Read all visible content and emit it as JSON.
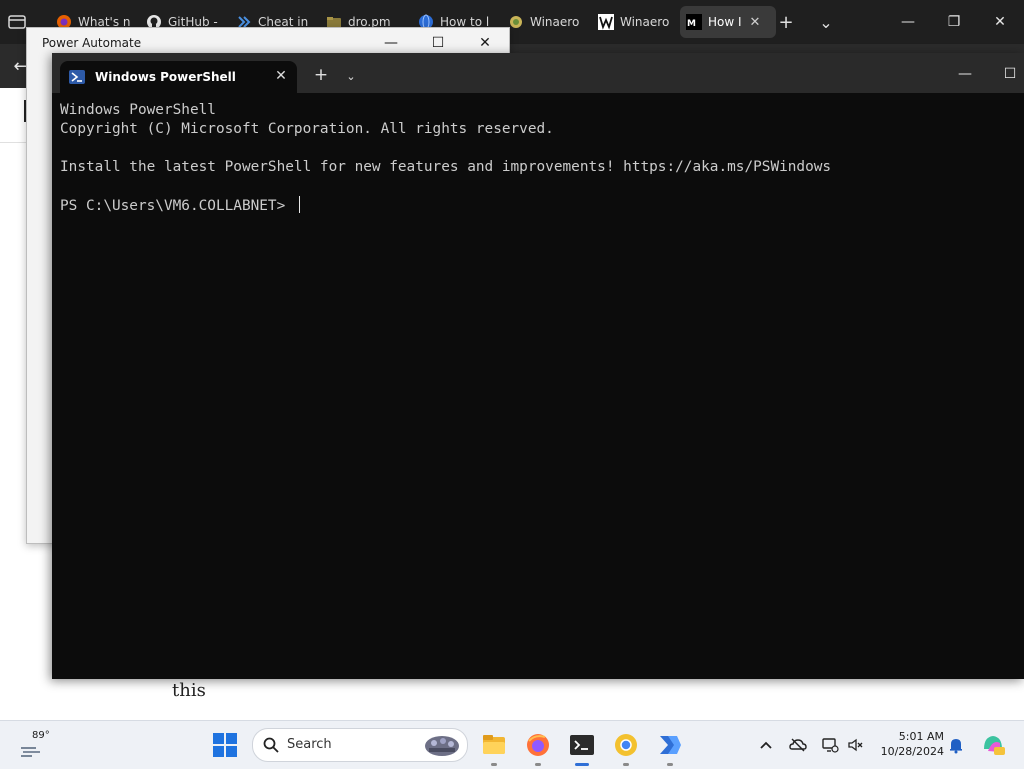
{
  "browser": {
    "tabs": [
      {
        "label": "What's n",
        "icon": "firefox-icon"
      },
      {
        "label": "GitHub -",
        "icon": "github-icon"
      },
      {
        "label": "Cheat in",
        "icon": "chevrons-icon"
      },
      {
        "label": "dro.pm",
        "icon": "folder-icon"
      },
      {
        "label": "How to l",
        "icon": "globe-icon"
      },
      {
        "label": "Winaero",
        "icon": "winaero-icon"
      },
      {
        "label": "Winaero",
        "icon": "w-logo-icon"
      },
      {
        "label": "How I",
        "icon": "medium-icon",
        "active": true
      }
    ],
    "active_close": "✕",
    "new_tab": "+",
    "list_tabs": "⌄",
    "minimize": "—",
    "restore": "❐",
    "close": "✕",
    "back": "←"
  },
  "page": {
    "word": "this"
  },
  "power_automate": {
    "title": "Power Automate",
    "minimize": "—",
    "maximize": "☐",
    "close": "✕"
  },
  "terminal": {
    "tab_label": "Windows PowerShell",
    "tab_close": "✕",
    "new_tab": "+",
    "dropdown": "⌄",
    "minimize": "—",
    "maximize": "☐",
    "lines": [
      "Windows PowerShell",
      "Copyright (C) Microsoft Corporation. All rights reserved.",
      "",
      "Install the latest PowerShell for new features and improvements! https://aka.ms/PSWindows",
      "",
      "PS C:\\Users\\VM6.COLLABNET> "
    ]
  },
  "taskbar": {
    "weather_temp": "89°",
    "search_label": "Search",
    "clock_time": "5:01 AM",
    "clock_date": "10/28/2024"
  },
  "colors": {
    "terminal_bg": "#0c0c0c",
    "terminal_text": "#cccccc",
    "taskbar_bg": "#eef1f6",
    "accent": "#2f6fd6"
  }
}
